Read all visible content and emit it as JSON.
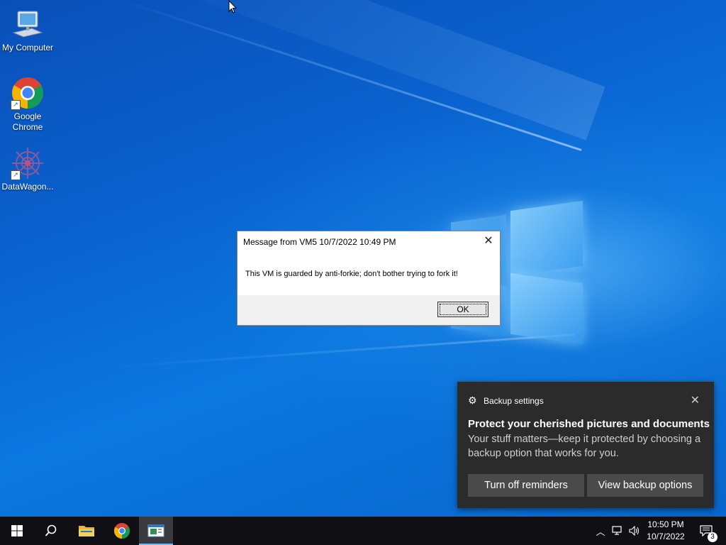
{
  "desktop": {
    "icons": [
      {
        "label": "My Computer",
        "icon": "monitor-icon"
      },
      {
        "label": "Google Chrome",
        "icon": "chrome-icon"
      },
      {
        "label": "DataWagon...",
        "icon": "datawagon-icon"
      }
    ]
  },
  "dialog": {
    "title": "Message from VM5 10/7/2022 10:49 PM",
    "message": "This VM is guarded by anti-forkie; don't bother trying to fork it!",
    "ok_label": "OK",
    "close_glyph": "✕"
  },
  "toast": {
    "app": "Backup settings",
    "heading": "Protect your cherished pictures and documents",
    "body": "Your stuff matters—keep it protected by choosing a backup option that works for you.",
    "button_primary": "Turn off reminders",
    "button_secondary": "View backup options",
    "close_glyph": "✕"
  },
  "taskbar": {
    "clock_time": "10:50 PM",
    "clock_date": "10/7/2022",
    "notification_count": "3",
    "items": [
      "start",
      "search",
      "file-explorer",
      "chrome",
      "active-app"
    ]
  },
  "colors": {
    "accent": "#76b9ed",
    "desktop_blue": "#0a63d0",
    "toast_bg": "#2b2b2b",
    "taskbar_bg": "#101014"
  }
}
